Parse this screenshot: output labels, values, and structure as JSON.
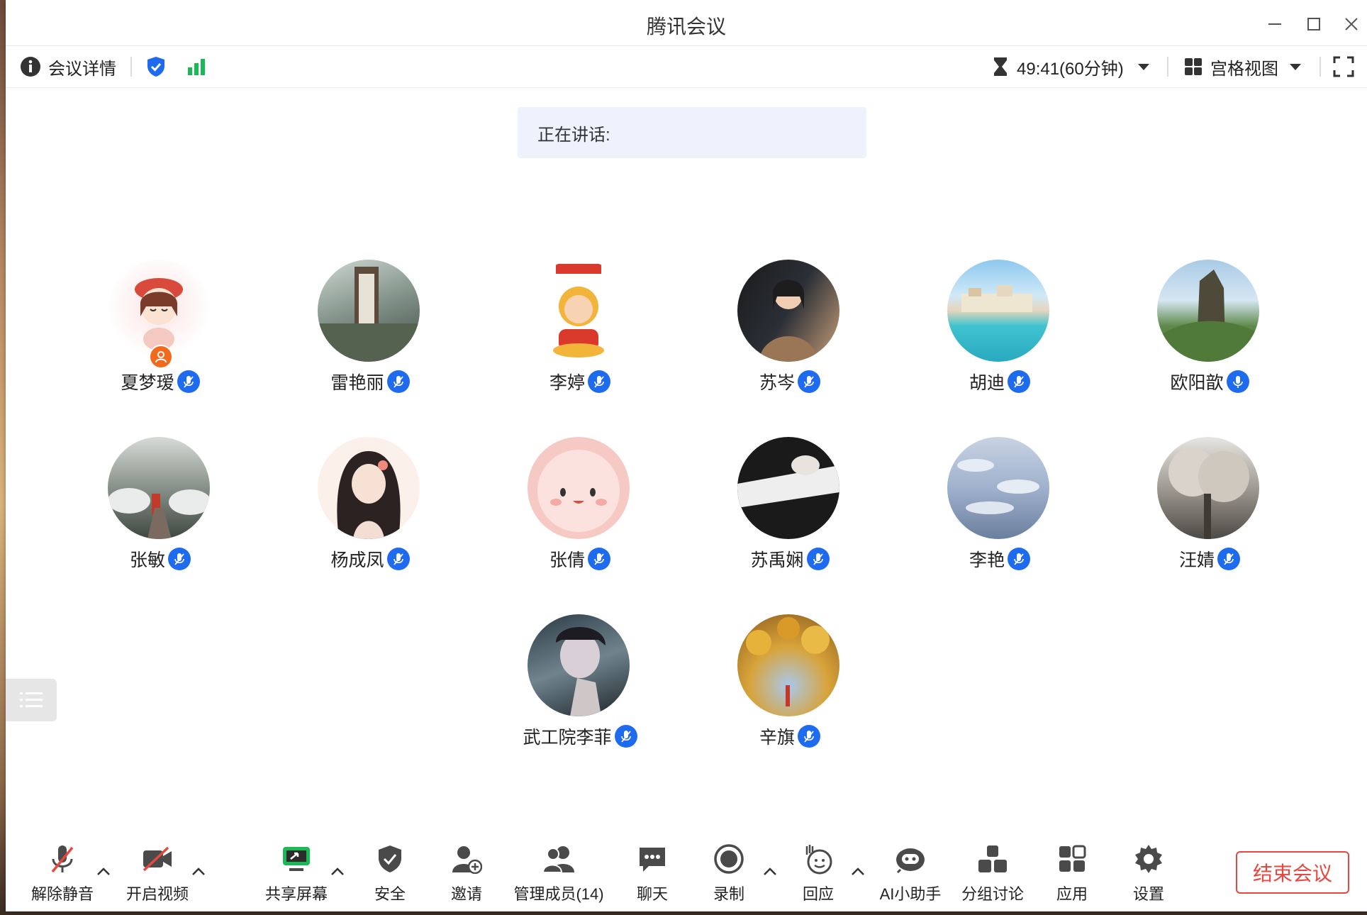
{
  "window": {
    "title": "腾讯会议"
  },
  "topbar": {
    "details_label": "会议详情",
    "timer": "49:41(60分钟)",
    "view_label": "宫格视图"
  },
  "speaking": {
    "label": "正在讲话:"
  },
  "participants": [
    {
      "name": "夏梦瑷",
      "host": true
    },
    {
      "name": "雷艳丽"
    },
    {
      "name": "李婷"
    },
    {
      "name": "苏岑"
    },
    {
      "name": "胡迪"
    },
    {
      "name": "欧阳歆"
    },
    {
      "name": "张敏"
    },
    {
      "name": "杨成凤"
    },
    {
      "name": "张倩"
    },
    {
      "name": "苏禹娴"
    },
    {
      "name": "李艳"
    },
    {
      "name": "汪婧"
    },
    {
      "name": "武工院李菲"
    },
    {
      "name": "辛旗"
    }
  ],
  "toolbar": {
    "unmute": "解除静音",
    "video": "开启视频",
    "share": "共享屏幕",
    "security": "安全",
    "invite": "邀请",
    "members": "管理成员(14)",
    "chat": "聊天",
    "record": "录制",
    "react": "回应",
    "ai": "AI小助手",
    "breakout": "分组讨论",
    "apps": "应用",
    "settings": "设置",
    "end": "结束会议"
  },
  "colors": {
    "accent": "#1f6bf0",
    "end": "#e8473f",
    "signal": "#19b955",
    "host": "#f26a1b"
  }
}
